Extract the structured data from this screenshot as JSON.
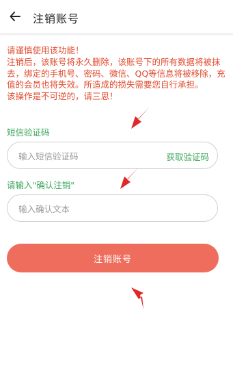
{
  "header": {
    "title": "注销账号",
    "back_icon": "arrow-left-icon"
  },
  "warning": {
    "lines": [
      "请谨慎使用该功能！",
      "注销后，该账号将永久删除，该账号下的所有数据将被抹去，绑定的手机号、密码、微信、QQ等信息将被移除，充值的会员也将失效。所造成的损失需要您自行承担。",
      "该操作是不可逆的，请三思！"
    ]
  },
  "sms": {
    "label": "短信验证码",
    "placeholder": "输入短信验证码",
    "get_code": "获取验证码"
  },
  "confirm": {
    "label": "请输入\"确认注销\"",
    "placeholder": "输入确认文本"
  },
  "submit": {
    "label": "注销账号"
  },
  "colors": {
    "warning": "#e04b2f",
    "accent_green": "#3aa55a",
    "button": "#ee6d5c",
    "annotation_arrow": "#e02828"
  }
}
